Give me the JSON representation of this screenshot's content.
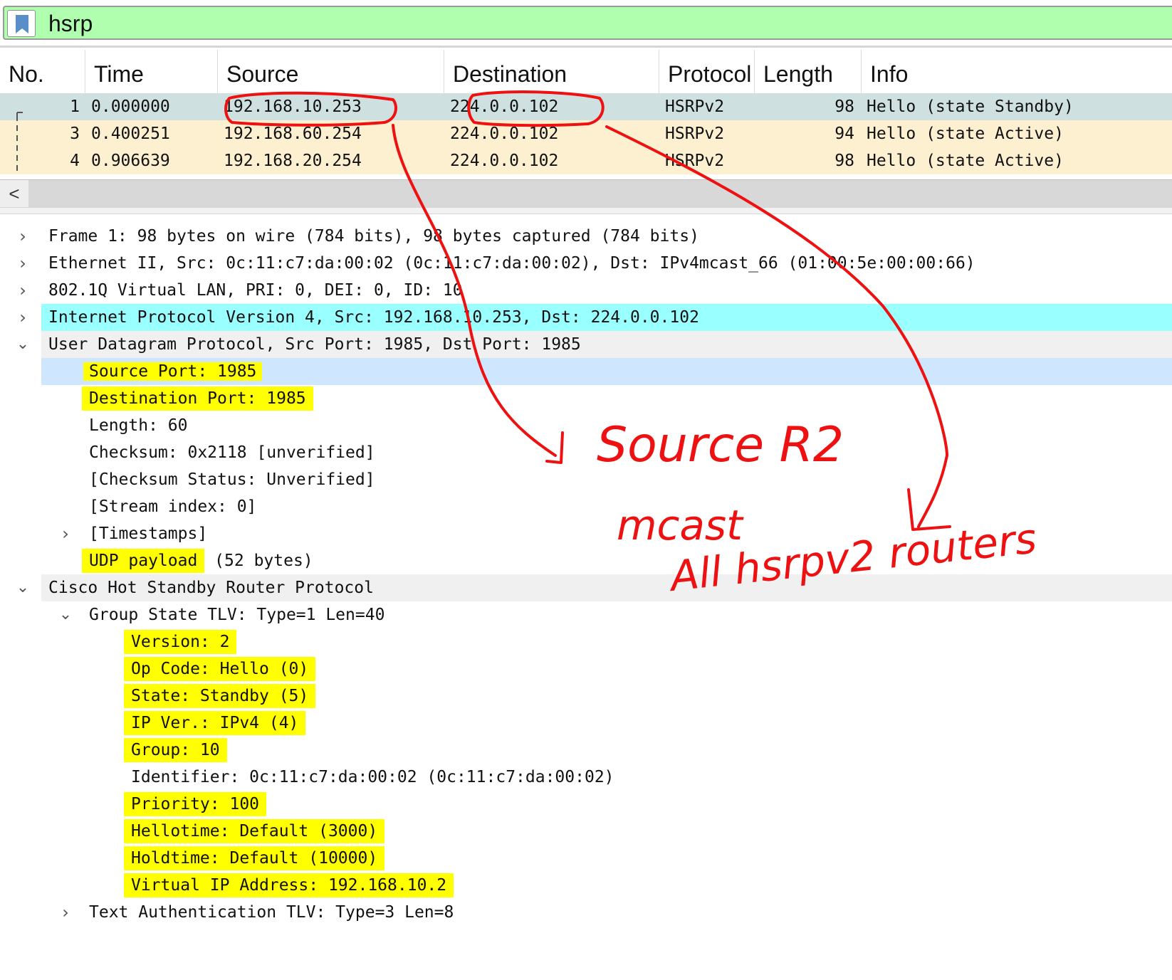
{
  "filter": {
    "value": "hsrp"
  },
  "packet_list": {
    "columns": [
      "No.",
      "Time",
      "Source",
      "Destination",
      "Protocol",
      "Length",
      "Info"
    ],
    "rows": [
      {
        "no": "1",
        "time": "0.000000",
        "source": "192.168.10.253",
        "destination": "224.0.0.102",
        "protocol": "HSRPv2",
        "length": "98",
        "info": "Hello (state Standby)",
        "selected": true
      },
      {
        "no": "3",
        "time": "0.400251",
        "source": "192.168.60.254",
        "destination": "224.0.0.102",
        "protocol": "HSRPv2",
        "length": "94",
        "info": "Hello (state Active)"
      },
      {
        "no": "4",
        "time": "0.906639",
        "source": "192.168.20.254",
        "destination": "224.0.0.102",
        "protocol": "HSRPv2",
        "length": "98",
        "info": "Hello (state Active)"
      }
    ],
    "scroll_left_glyph": "<"
  },
  "details": {
    "frame": "Frame 1: 98 bytes on wire (784 bits), 98 bytes captured (784 bits)",
    "ethernet": "Ethernet II, Src: 0c:11:c7:da:00:02 (0c:11:c7:da:00:02), Dst: IPv4mcast_66 (01:00:5e:00:00:66)",
    "vlan": "802.1Q Virtual LAN, PRI: 0, DEI: 0, ID: 10",
    "ip": "Internet Protocol Version 4, Src: 192.168.10.253, Dst: 224.0.0.102",
    "udp": "User Datagram Protocol, Src Port: 1985, Dst Port: 1985",
    "udp_fields": {
      "src_port": "Source Port: 1985",
      "dst_port": "Destination Port: 1985",
      "length": "Length: 60",
      "checksum": "Checksum: 0x2118 [unverified]",
      "checksum_status": "[Checksum Status: Unverified]",
      "stream_index": "[Stream index: 0]",
      "timestamps": "[Timestamps]",
      "payload_label": "UDP payload",
      "payload_rest": " (52 bytes)"
    },
    "hsrp": "Cisco Hot Standby Router Protocol",
    "group_state": "Group State TLV: Type=1 Len=40",
    "group_fields": {
      "version": "Version: 2",
      "opcode": "Op Code: Hello (0)",
      "state": "State: Standby (5)",
      "ipver": "IP Ver.: IPv4 (4)",
      "group": "Group: 10",
      "identifier": "Identifier: 0c:11:c7:da:00:02 (0c:11:c7:da:00:02)",
      "priority": "Priority: 100",
      "hellotime": "Hellotime: Default (3000)",
      "holdtime": "Holdtime: Default (10000)",
      "vip": "Virtual IP Address: 192.168.10.2"
    },
    "text_auth": "Text Authentication TLV: Type=3 Len=8"
  },
  "annotations": {
    "source_note": "Source R2",
    "mcast_line1": "mcast",
    "mcast_line2": "All hsrpv2 routers",
    "ink_color": "#ee1111",
    "highlight_color": "#ffff00"
  },
  "colors": {
    "filter_bg": "#afffaf",
    "row_selected": "#cfe0e0",
    "row_normal": "#fdf0d0",
    "ip_row": "#99ffff",
    "section_row": "#f0f0f0",
    "src_port_row": "#cfe6ff"
  }
}
